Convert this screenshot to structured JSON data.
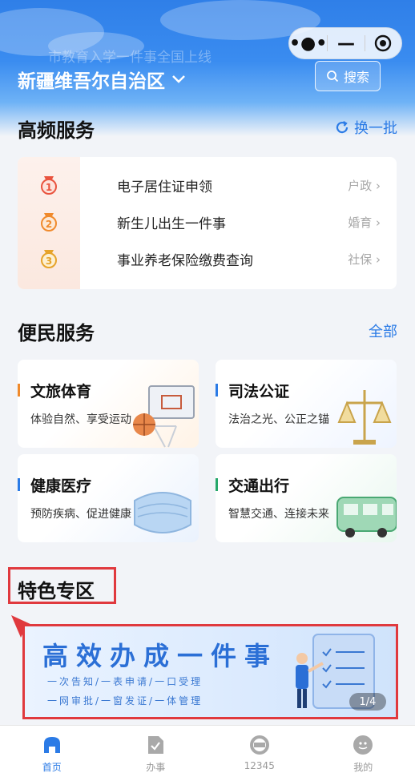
{
  "header": {
    "marquee": "市教育入学一件事全国上线",
    "region": "新疆维吾尔自治区",
    "search_label": "搜索"
  },
  "hot": {
    "title": "高频服务",
    "refresh_label": "换一批",
    "items": [
      {
        "rank": "1",
        "name": "电子居住证申领",
        "tag": "户政"
      },
      {
        "rank": "2",
        "name": "新生儿出生一件事",
        "tag": "婚育"
      },
      {
        "rank": "3",
        "name": "事业养老保险缴费查询",
        "tag": "社保"
      }
    ]
  },
  "convenience": {
    "title": "便民服务",
    "all_label": "全部",
    "cards": [
      {
        "title": "文旅体育",
        "subtitle": "体验自然、享受运动",
        "accent": "#f08a2c"
      },
      {
        "title": "司法公证",
        "subtitle": "法治之光、公正之锚",
        "accent": "#2b7be6"
      },
      {
        "title": "健康医疗",
        "subtitle": "预防疾病、促进健康",
        "accent": "#2b7be6"
      },
      {
        "title": "交通出行",
        "subtitle": "智慧交通、连接未来",
        "accent": "#26a86a"
      }
    ]
  },
  "special": {
    "title": "特色专区",
    "banner_title": "高效办成一件事",
    "banner_line1": "一次告知/一表申请/一口受理",
    "banner_line2": "一网审批/一窗发证/一体管理",
    "pager": "1/4"
  },
  "tabbar": [
    {
      "label": "首页",
      "icon": "home-icon",
      "active": true
    },
    {
      "label": "办事",
      "icon": "document-icon",
      "active": false
    },
    {
      "label": "12345",
      "icon": "hotline-icon",
      "active": false
    },
    {
      "label": "我的",
      "icon": "profile-icon",
      "active": false
    }
  ],
  "colors": {
    "primary": "#2b7be6",
    "highlight": "#e0393e"
  }
}
